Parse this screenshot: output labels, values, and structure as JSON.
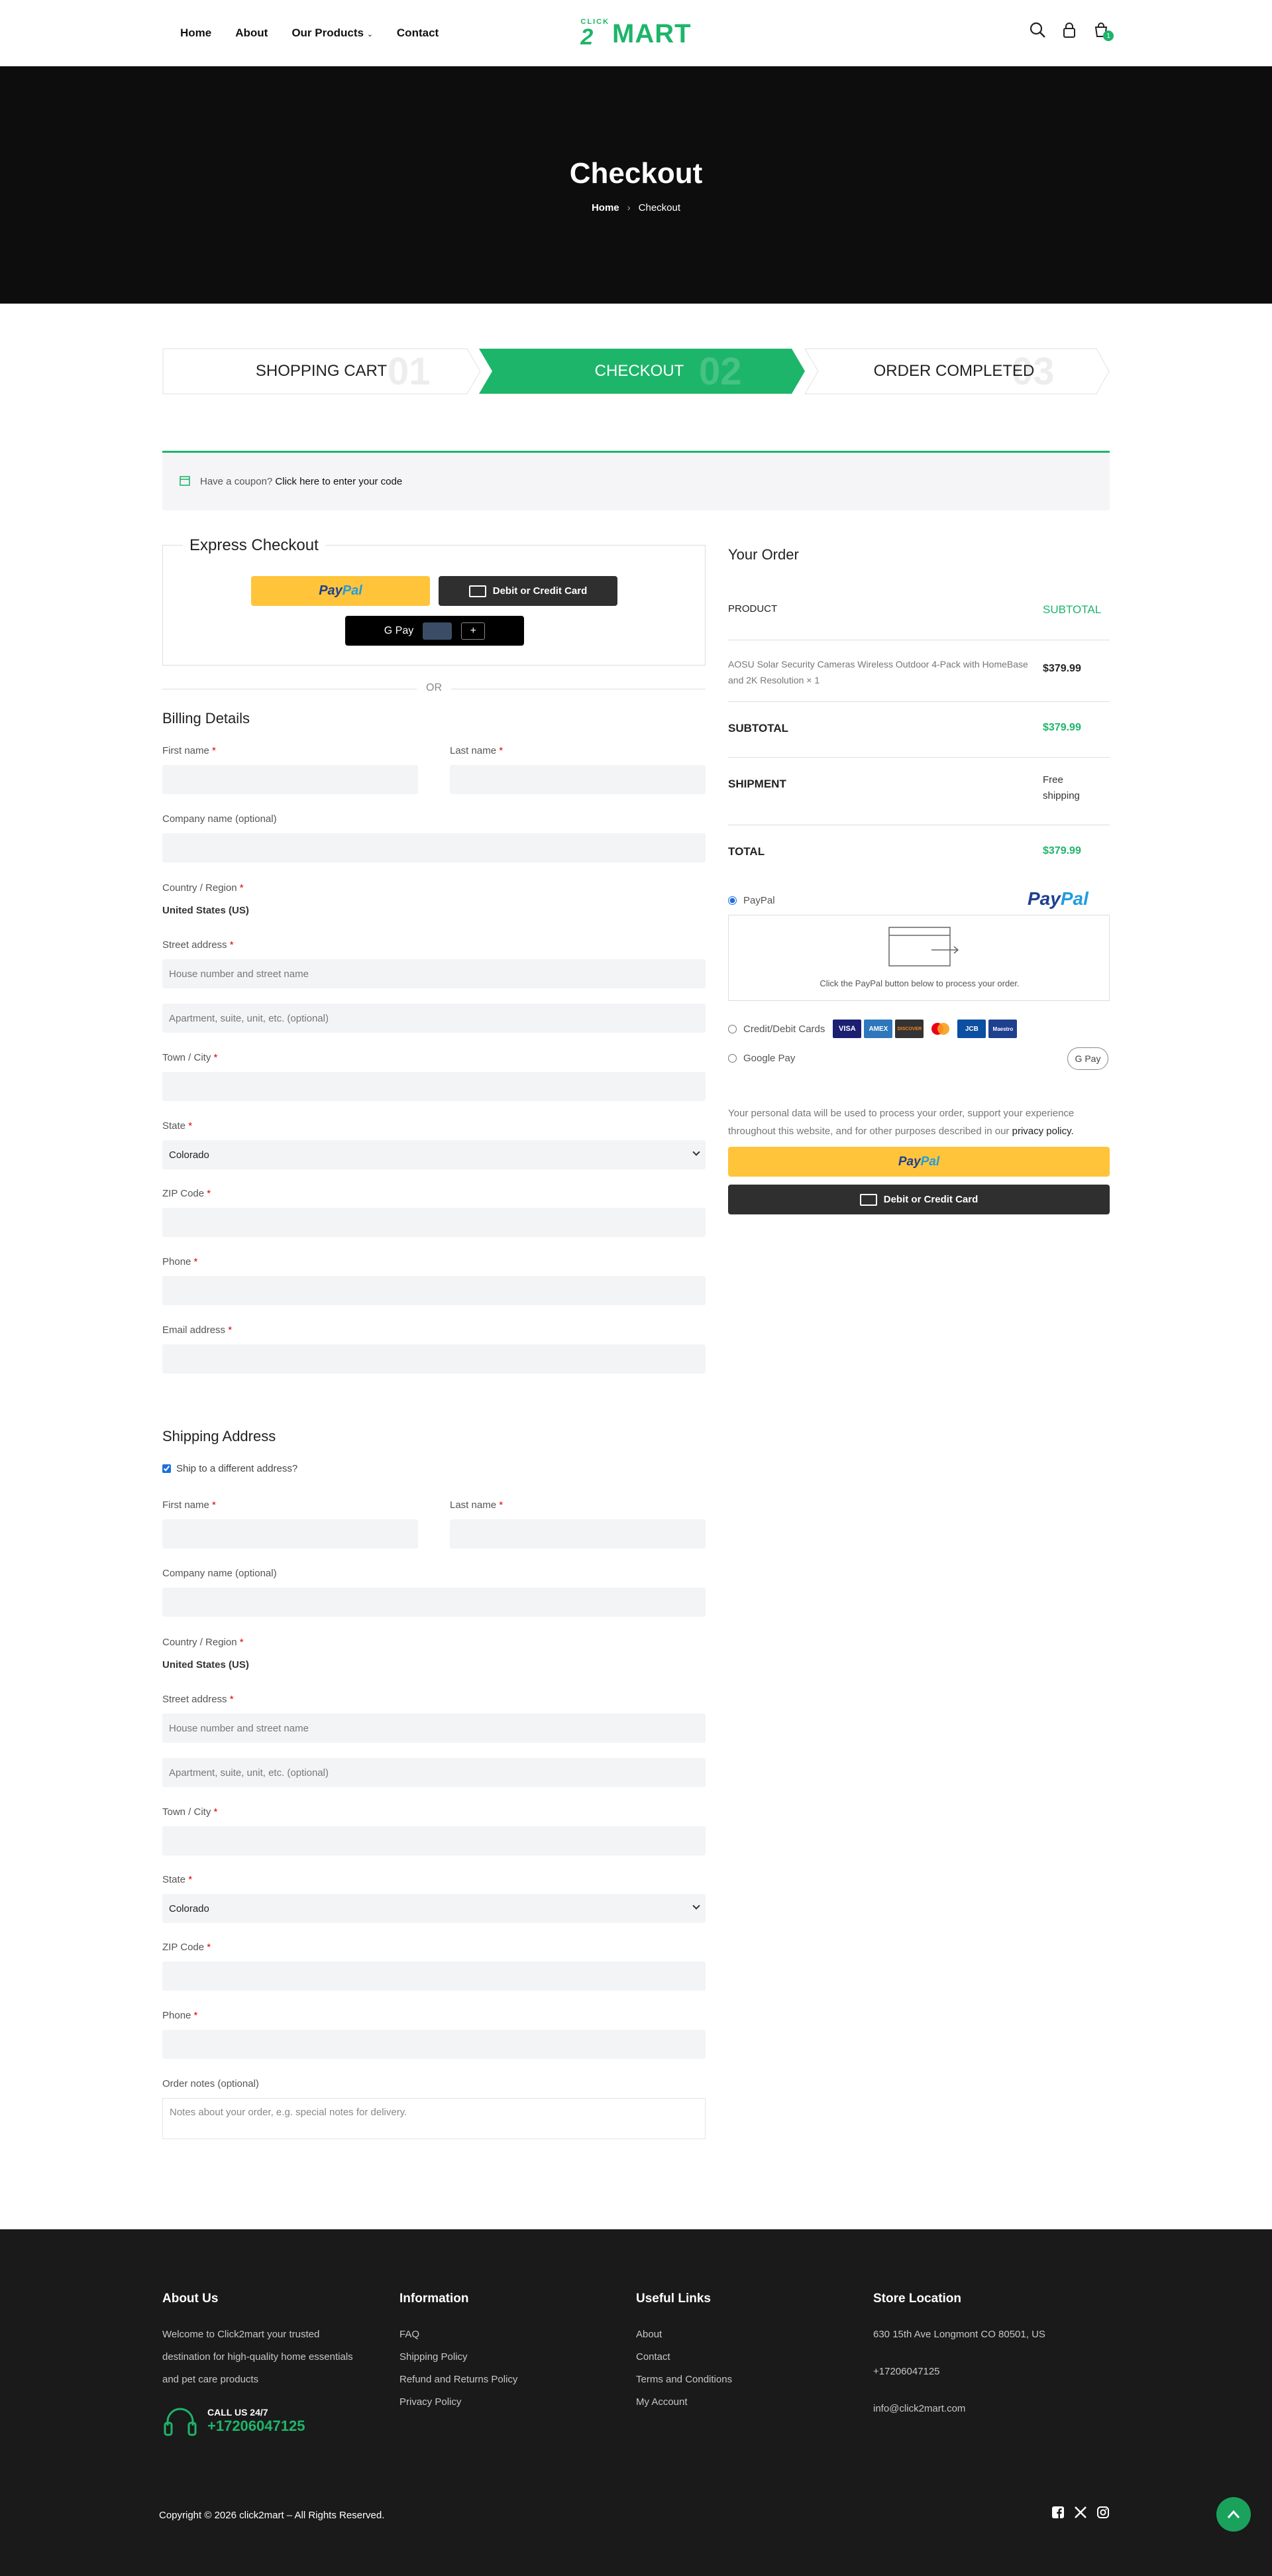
{
  "header": {
    "nav": [
      "Home",
      "About",
      "Our Products",
      "Contact"
    ],
    "logo_small": "CLICK",
    "logo_num": "2",
    "logo_big": "MART",
    "cart_count": "1"
  },
  "hero": {
    "title": "Checkout",
    "crumb_home": "Home",
    "crumb_current": "Checkout"
  },
  "steps": [
    {
      "label": "SHOPPING CART",
      "num": "01"
    },
    {
      "label": "CHECKOUT",
      "num": "02"
    },
    {
      "label": "ORDER COMPLETED",
      "num": "03"
    }
  ],
  "coupon": {
    "text": "Have a coupon?",
    "link": "Click here to enter your code"
  },
  "express": {
    "title": "Express Checkout",
    "paypal_a": "Pay",
    "paypal_b": "Pal",
    "card_label": "Debit or Credit Card",
    "gpay_label": "G Pay",
    "or": "OR"
  },
  "billing": {
    "title": "Billing Details",
    "first_name": "First name",
    "last_name": "Last name",
    "company": "Company name (optional)",
    "country": "Country / Region",
    "country_value": "United States (US)",
    "street": "Street address",
    "street_ph": "House number and street name",
    "apt_ph": "Apartment, suite, unit, etc. (optional)",
    "city": "Town / City",
    "state": "State",
    "state_value": "Colorado",
    "zip": "ZIP Code",
    "phone": "Phone",
    "email": "Email address",
    "req": "*"
  },
  "shipping": {
    "title": "Shipping Address",
    "ship_diff": "Ship to a different address?",
    "first_name": "First name",
    "last_name": "Last name",
    "company": "Company name (optional)",
    "country": "Country / Region",
    "country_value": "United States (US)",
    "street": "Street address",
    "street_ph": "House number and street name",
    "apt_ph": "Apartment, suite, unit, etc. (optional)",
    "city": "Town / City",
    "state": "State",
    "state_value": "Colorado",
    "zip": "ZIP Code",
    "phone": "Phone",
    "notes": "Order notes (optional)",
    "notes_ph": "Notes about your order, e.g. special notes for delivery.",
    "req": "*"
  },
  "order": {
    "title": "Your Order",
    "col_product": "PRODUCT",
    "col_subtotal": "SUBTOTAL",
    "product_name": "AOSU Solar Security Cameras Wireless Outdoor 4-Pack with HomeBase and 2K Resolution × 1",
    "product_price": "$379.99",
    "subtotal_label": "SUBTOTAL",
    "subtotal_value": "$379.99",
    "shipment_label": "SHIPMENT",
    "shipment_value": "Free shipping",
    "total_label": "TOTAL",
    "total_value": "$379.99"
  },
  "payment": {
    "paypal": "PayPal",
    "paypal_logo_a": "Pay",
    "paypal_logo_b": "Pal",
    "paypal_hint": "Click the PayPal button below to process your order.",
    "cards": "Credit/Debit Cards",
    "card_logos": [
      "VISA",
      "AMEX",
      "DISCOVER",
      "MC",
      "JCB",
      "Maestro"
    ],
    "gpay": "Google Pay",
    "gpay_badge": "G Pay",
    "privacy": "Your personal data will be used to process your order, support your experience throughout this website, and for other purposes described in our",
    "privacy_link": "privacy policy.",
    "btn_paypal_a": "Pay",
    "btn_paypal_b": "Pal",
    "btn_card": "Debit or Credit Card"
  },
  "footer": {
    "about_title": "About Us",
    "about_text": "Welcome to Click2mart your trusted destination for high-quality home essentials and pet care products",
    "call_label": "CALL US 24/7",
    "call_number": "+17206047125",
    "info_title": "Information",
    "info_items": [
      "FAQ",
      "Shipping Policy",
      "Refund and Returns Policy",
      "Privacy Policy"
    ],
    "links_title": "Useful Links",
    "links_items": [
      "About",
      "Contact",
      "Terms and Conditions",
      "My Account"
    ],
    "store_title": "Store Location",
    "store_address": "630 15th Ave Longmont CO 80501, US",
    "store_phone": "+17206047125",
    "store_email": "info@click2mart.com",
    "copyright": "Copyright © 2026 click2mart – All Rights Reserved."
  },
  "colors": {
    "accent": "#1db56a",
    "dark": "#0d0d0d",
    "paypal_yellow": "#ffc43a"
  }
}
